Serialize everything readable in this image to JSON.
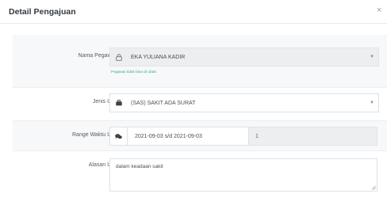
{
  "modal": {
    "title": "Detail Pengajuan",
    "close_glyph": "×"
  },
  "form": {
    "nama_pegawai": {
      "label": "Nama Pegawai",
      "value": "EKA YULIANA KADIR",
      "icon": "lock-icon",
      "help": "Pegawai tidak bisa di ubah"
    },
    "jenis_izin": {
      "label": "Jenis Izin",
      "value": "(SAS) SAKIT ADA SURAT",
      "icon": "briefcase-icon"
    },
    "range_waktu": {
      "label": "Range Waktu Izin",
      "value": "2021-09-03 s/d 2021-09-03",
      "days": "1",
      "icon": "comments-icon"
    },
    "alasan_izin": {
      "label": "Alasan Izin",
      "value": "dalam keadaan sakit"
    }
  },
  "colors": {
    "help_text": "#2fb380",
    "disabled_bg": "#eceef0",
    "title": "#333a40"
  }
}
